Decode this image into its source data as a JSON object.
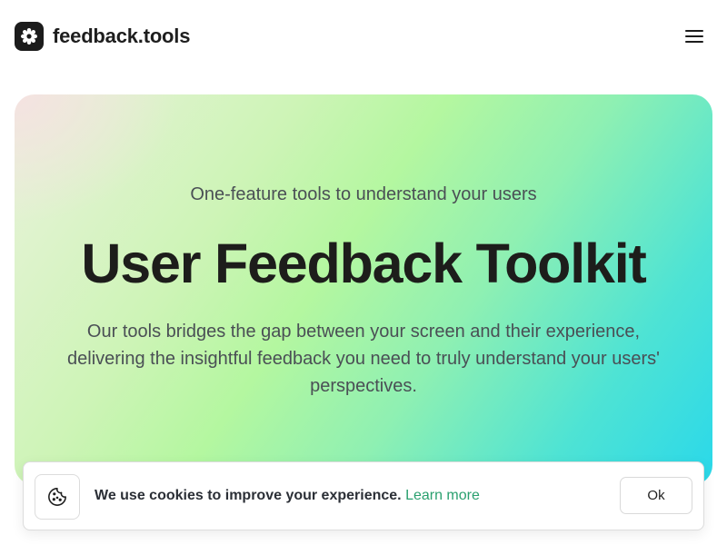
{
  "header": {
    "brand_name": "feedback.tools",
    "logo_icon": "asterisk-flower-icon",
    "menu_icon": "hamburger-menu-icon"
  },
  "hero": {
    "subtitle": "One-feature tools to understand your users",
    "title": "User Feedback Toolkit",
    "description": "Our tools bridges the gap between your screen and their experience, delivering the insightful feedback you need to truly understand your users' perspectives."
  },
  "cookie_banner": {
    "icon": "cookie-icon",
    "message": "We use cookies to improve your experience.",
    "link_label": "Learn more",
    "ok_label": "Ok"
  },
  "colors": {
    "brand_dark": "#1c1c1c",
    "link_green": "#2aa06f",
    "gradient_green": "#b4f7a0",
    "gradient_cyan": "#2ad8ea"
  }
}
